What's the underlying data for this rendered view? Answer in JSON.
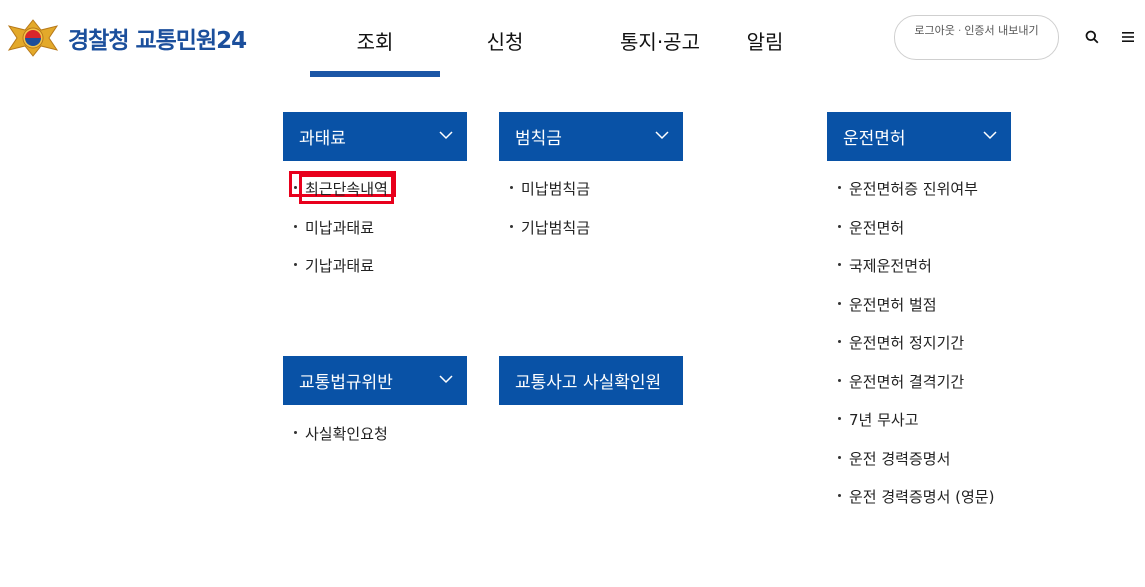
{
  "header": {
    "logo_text": "경찰청 교통민원24",
    "nav": [
      {
        "label": "조회",
        "active": true
      },
      {
        "label": "신청",
        "active": false
      },
      {
        "label": "통지·공고",
        "active": false
      },
      {
        "label": "알림",
        "active": false
      }
    ],
    "util": {
      "logout": "로그아웃",
      "cert_export": "인증서 내보내기"
    },
    "search_icon": "search-icon",
    "menu_icon": "hamburger-menu-icon"
  },
  "colors": {
    "brand_blue": "#0952a6",
    "nav_underline": "#1b56a6",
    "highlight_red": "#e8001c"
  },
  "menu": {
    "fine": {
      "title": "과태료",
      "items": [
        "최근단속내역",
        "미납과태료",
        "기납과태료"
      ],
      "highlighted_item": "최근단속내역"
    },
    "penalty": {
      "title": "범칙금",
      "items": [
        "미납범칙금",
        "기납범칙금"
      ]
    },
    "license": {
      "title": "운전면허",
      "items": [
        "운전면허증 진위여부",
        "운전면허",
        "국제운전면허",
        "운전면허 벌점",
        "운전면허 정지기간",
        "운전면허 결격기간",
        "7년 무사고",
        "운전 경력증명서",
        "운전 경력증명서 (영문)"
      ]
    },
    "violation": {
      "title": "교통법규위반",
      "items": [
        "사실확인요청"
      ]
    },
    "accident": {
      "title": "교통사고 사실확인원"
    }
  }
}
